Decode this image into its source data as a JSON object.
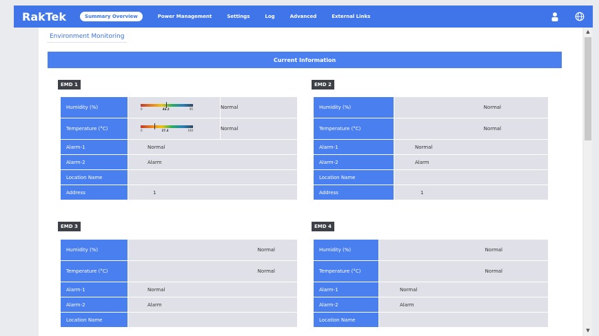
{
  "app": {
    "brand": "RakTek"
  },
  "nav": {
    "active": "Summary Overview",
    "items": [
      "Power Management",
      "Settings",
      "Log",
      "Advanced",
      "External Links"
    ]
  },
  "icons": {
    "user": "user-icon",
    "globe": "globe-icon"
  },
  "colors": {
    "accent": "#3f75e8",
    "normal": "#2e7a3a",
    "alarm": "#c0392b"
  },
  "page": {
    "tab": "Environment Monitoring",
    "section_title": "Current Information"
  },
  "labels": {
    "humidity": "Humidity (%)",
    "temperature": "Temperature (°C)",
    "alarm1": "Alarm-1",
    "alarm2": "Alarm-2",
    "location": "Location Name",
    "address": "Address"
  },
  "emds": [
    {
      "name": "EMD 1",
      "humidity": {
        "min": "0",
        "value": "46.2",
        "max": "95",
        "status": "Normal"
      },
      "temperature": {
        "min": "0",
        "value": "27.4",
        "max": "100",
        "status": "Normal"
      },
      "alarm1": "Normal",
      "alarm2": "Alarm",
      "location": "",
      "address": "1"
    },
    {
      "name": "EMD 2",
      "humidity": {
        "status": "Normal"
      },
      "temperature": {
        "status": "Normal"
      },
      "alarm1": "Normal",
      "alarm2": "Alarm",
      "location": "",
      "address": "1"
    },
    {
      "name": "EMD 3",
      "humidity": {
        "status": "Normal"
      },
      "temperature": {
        "status": "Normal"
      },
      "alarm1": "Normal",
      "alarm2": "Alarm",
      "location": ""
    },
    {
      "name": "EMD 4",
      "humidity": {
        "status": "Normal"
      },
      "temperature": {
        "status": "Normal"
      },
      "alarm1": "Normal",
      "alarm2": "Alarm",
      "location": ""
    }
  ]
}
